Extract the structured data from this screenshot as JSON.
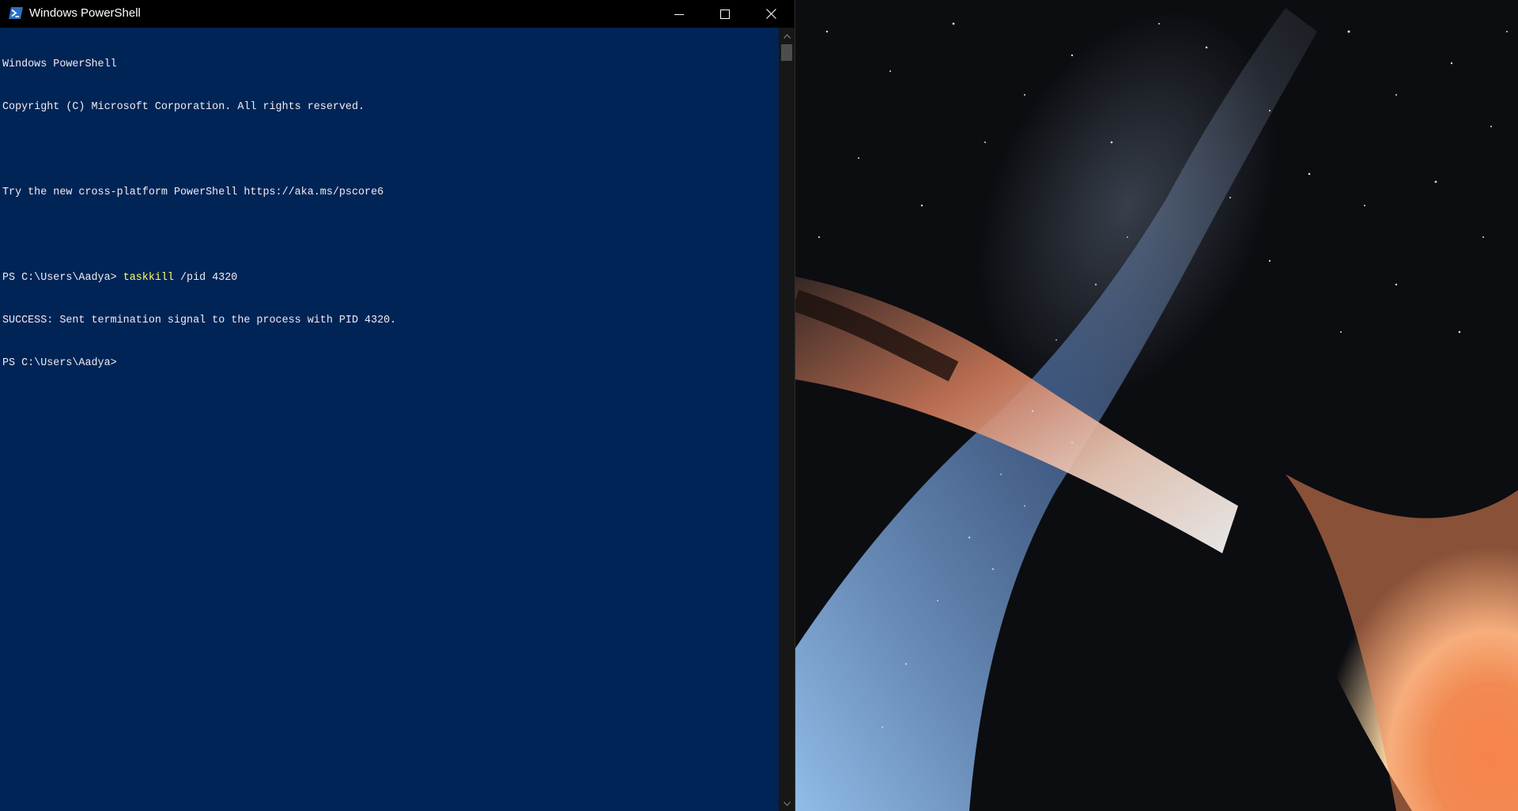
{
  "window": {
    "title": "Windows PowerShell",
    "icon": "powershell-icon",
    "buttons": {
      "minimize": "minimize-icon",
      "maximize": "maximize-icon",
      "close": "close-icon"
    }
  },
  "console": {
    "line_1": "Windows PowerShell",
    "line_2": "Copyright (C) Microsoft Corporation. All rights reserved.",
    "line_4": "Try the new cross-platform PowerShell https://aka.ms/pscore6",
    "prompt_1": "PS C:\\Users\\Aadya> ",
    "command_name": "taskkill",
    "command_args": " /pid 4320",
    "output_1": "SUCCESS: Sent termination signal to the process with PID 4320.",
    "prompt_2": "PS C:\\Users\\Aadya>"
  },
  "colors": {
    "console_background": "#012456",
    "console_text": "#eeedf0",
    "command_highlight": "#ffff66",
    "titlebar": "#000000",
    "scrollbar": "#171717"
  },
  "scrollbar": {
    "arrows": [
      "scroll-up-arrow-icon",
      "scroll-down-arrow-icon"
    ]
  }
}
